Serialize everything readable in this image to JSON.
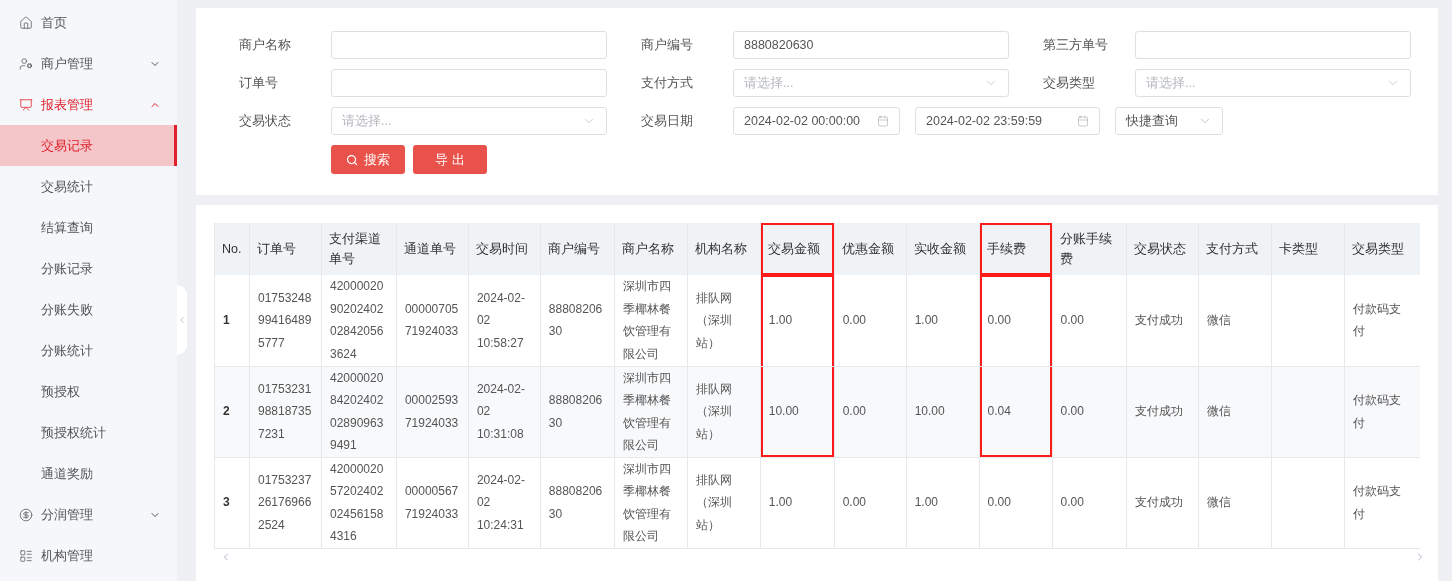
{
  "sidebar": {
    "items": [
      {
        "label": "首页",
        "selected": false
      },
      {
        "label": "商户管理",
        "selected": false,
        "expanded": false
      },
      {
        "label": "报表管理",
        "selected": true,
        "expanded": true,
        "children": [
          {
            "label": "交易记录",
            "selected": true
          },
          {
            "label": "交易统计",
            "selected": false
          },
          {
            "label": "结算查询",
            "selected": false
          },
          {
            "label": "分账记录",
            "selected": false
          },
          {
            "label": "分账失败",
            "selected": false
          },
          {
            "label": "分账统计",
            "selected": false
          },
          {
            "label": "预授权",
            "selected": false
          },
          {
            "label": "预授权统计",
            "selected": false
          },
          {
            "label": "通道奖励",
            "selected": false
          }
        ]
      },
      {
        "label": "分润管理",
        "selected": false,
        "expanded": false
      },
      {
        "label": "机构管理",
        "selected": false
      }
    ]
  },
  "filters": [
    {
      "kind": "text",
      "label": "商户名称"
    },
    {
      "kind": "text",
      "label": "商户编号",
      "value": "8880820630"
    },
    {
      "kind": "text",
      "label": "第三方单号"
    },
    {
      "kind": "text",
      "label": "订单号"
    },
    {
      "kind": "select",
      "label": "支付方式",
      "placeholder": "请选择..."
    },
    {
      "kind": "select",
      "label": "交易类型",
      "placeholder": "请选择..."
    },
    {
      "kind": "select",
      "label": "交易状态",
      "placeholder": "请选择..."
    },
    {
      "kind": "daterange",
      "label": "交易日期",
      "start": "2024-02-02 00:00:00",
      "end": "2024-02-02 23:59:59",
      "quick": "快捷查询"
    }
  ],
  "buttons": [
    {
      "kind": "search",
      "label": "搜索"
    },
    {
      "kind": "plain",
      "label": "导 出"
    }
  ],
  "table": {
    "columns": [
      {
        "label": "No.",
        "marked": false
      },
      {
        "label": "订单号",
        "marked": false
      },
      {
        "label": "支付渠道单号",
        "marked": false
      },
      {
        "label": "通道单号",
        "marked": false
      },
      {
        "label": "交易时间",
        "marked": false
      },
      {
        "label": "商户编号",
        "marked": false
      },
      {
        "label": "商户名称",
        "marked": false
      },
      {
        "label": "机构名称",
        "marked": false
      },
      {
        "label": "交易金额",
        "marked": true
      },
      {
        "label": "优惠金额",
        "marked": false
      },
      {
        "label": "实收金额",
        "marked": false
      },
      {
        "label": "手续费",
        "marked": true
      },
      {
        "label": "分账手续费",
        "marked": false
      },
      {
        "label": "交易状态",
        "marked": false
      },
      {
        "label": "支付方式",
        "marked": false
      },
      {
        "label": "卡类型",
        "marked": false
      },
      {
        "label": "交易类型",
        "marked": false
      }
    ],
    "rows": [
      {
        "marked": true,
        "cells": [
          "1",
          "01753248994164895777",
          "4200002090202402028420563624",
          "0000070571924033",
          "2024-02-02 10:58:27",
          "8880820630",
          "深圳市四季椰林餐饮管理有限公司",
          "排队网（深圳站）",
          "1.00",
          "0.00",
          "1.00",
          "0.00",
          "0.00",
          "支付成功",
          "微信",
          "",
          "付款码支付"
        ]
      },
      {
        "marked": true,
        "cells": [
          "2",
          "01753231988187357231",
          "4200002084202402028909639491",
          "0000259371924033",
          "2024-02-02 10:31:08",
          "8880820630",
          "深圳市四季椰林餐饮管理有限公司",
          "排队网（深圳站）",
          "10.00",
          "0.00",
          "10.00",
          "0.04",
          "0.00",
          "支付成功",
          "微信",
          "",
          "付款码支付"
        ]
      },
      {
        "marked": false,
        "cells": [
          "3",
          "01753237261769662524",
          "4200002057202402024561584316",
          "0000056771924033",
          "2024-02-02 10:24:31",
          "8880820630",
          "深圳市四季椰林餐饮管理有限公司",
          "排队网（深圳站）",
          "1.00",
          "0.00",
          "1.00",
          "0.00",
          "0.00",
          "支付成功",
          "微信",
          "",
          "付款码支付"
        ]
      }
    ]
  }
}
